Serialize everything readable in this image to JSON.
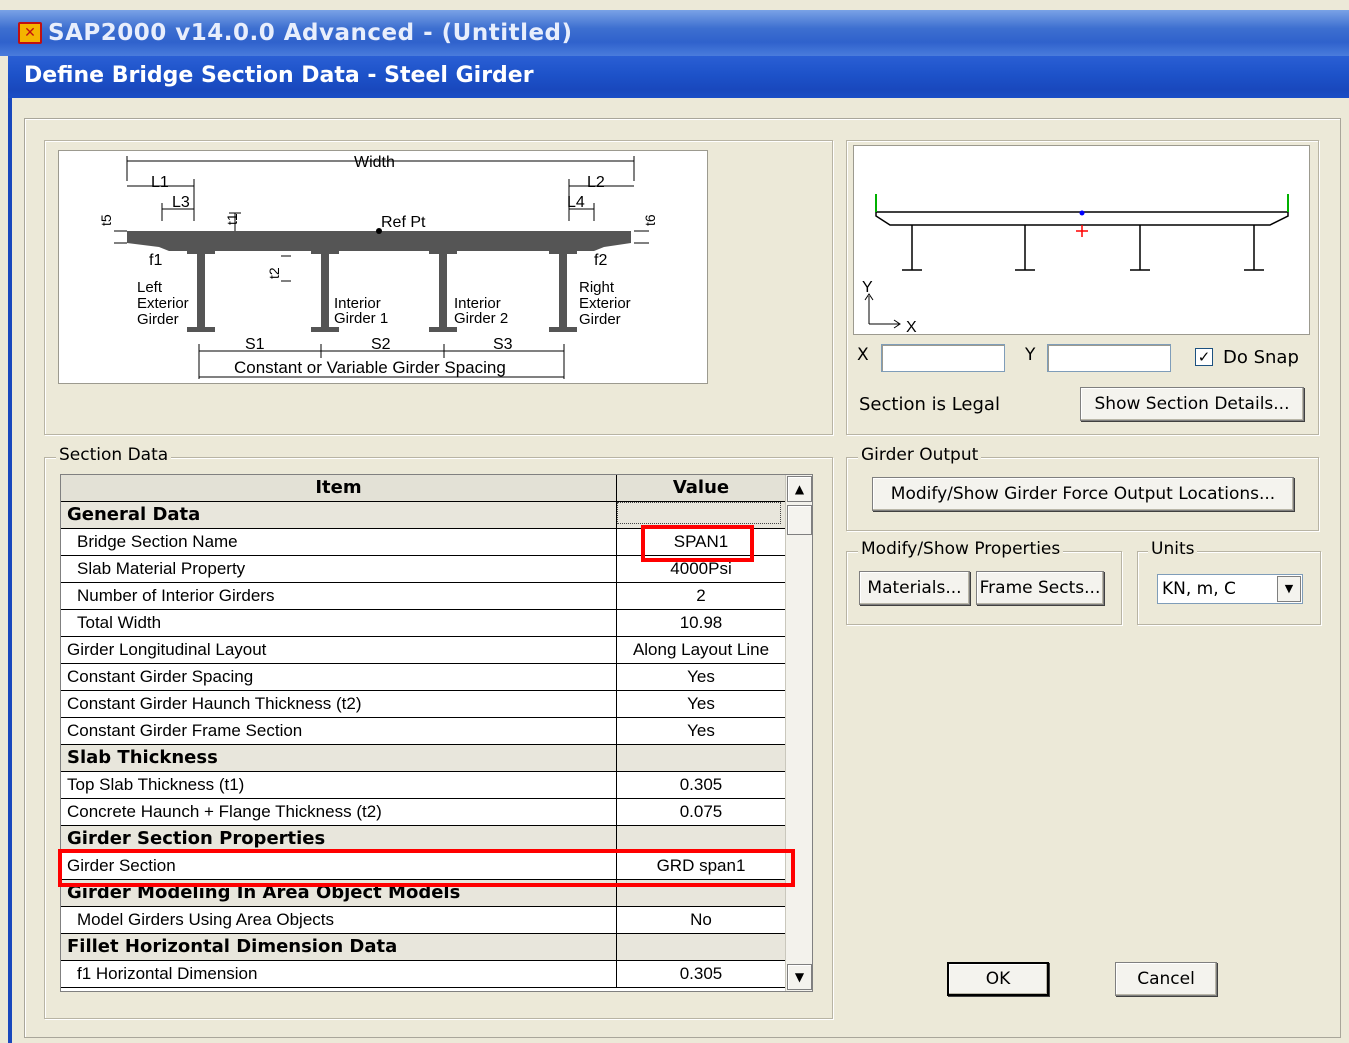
{
  "window": {
    "app_title": "SAP2000 v14.0.0 Advanced  - (Untitled)",
    "dialog_title": "Define Bridge Section Data - Steel Girder"
  },
  "diagram": {
    "width_label": "Width",
    "l1": "L1",
    "l2": "L2",
    "l3": "L3",
    "l4": "L4",
    "t5": "t5",
    "t6": "t6",
    "t1": "t1",
    "t2": "t2",
    "ref_pt": "Ref Pt",
    "f1": "f1",
    "f2": "f2",
    "left_girder": [
      "Left",
      "Exterior",
      "Girder"
    ],
    "interior1": [
      "Interior",
      "Girder 1"
    ],
    "interior2": [
      "Interior",
      "Girder 2"
    ],
    "right_girder": [
      "Right",
      "Exterior",
      "Girder"
    ],
    "s1": "S1",
    "s2": "S2",
    "s3": "S3",
    "spacing_label": "Constant or Variable Girder Spacing"
  },
  "preview": {
    "axis_y": "Y",
    "axis_x": "X",
    "x_label": "X",
    "y_label": "Y",
    "x_value": "",
    "y_value": "",
    "do_snap_label": "Do Snap",
    "do_snap_checked": true,
    "status": "Section is Legal",
    "show_details_button": "Show Section Details..."
  },
  "section_data": {
    "group_label": "Section Data",
    "columns": [
      "Item",
      "Value"
    ],
    "rows": [
      {
        "item": "General Data",
        "value": "",
        "kind": "section"
      },
      {
        "item": "Bridge Section Name",
        "value": "SPAN1",
        "kind": "indent"
      },
      {
        "item": "Slab Material Property",
        "value": "4000Psi",
        "kind": "indent"
      },
      {
        "item": "Number of Interior Girders",
        "value": "2",
        "kind": "indent"
      },
      {
        "item": "Total Width",
        "value": "10.98",
        "kind": "indent"
      },
      {
        "item": "Girder Longitudinal Layout",
        "value": "Along Layout Line",
        "kind": "plain"
      },
      {
        "item": "Constant Girder Spacing",
        "value": "Yes",
        "kind": "plain"
      },
      {
        "item": "Constant Girder Haunch Thickness (t2)",
        "value": "Yes",
        "kind": "plain"
      },
      {
        "item": "Constant Girder Frame Section",
        "value": "Yes",
        "kind": "plain"
      },
      {
        "item": "Slab Thickness",
        "value": "",
        "kind": "section"
      },
      {
        "item": "Top Slab Thickness (t1)",
        "value": "0.305",
        "kind": "plain"
      },
      {
        "item": "Concrete Haunch + Flange Thickness (t2)",
        "value": "0.075",
        "kind": "plain"
      },
      {
        "item": "Girder Section Properties",
        "value": "",
        "kind": "section"
      },
      {
        "item": "Girder Section",
        "value": "GRD span1",
        "kind": "plain"
      },
      {
        "item": "Girder Modeling In Area Object Models",
        "value": "",
        "kind": "section"
      },
      {
        "item": "Model Girders Using Area Objects",
        "value": "No",
        "kind": "indent"
      },
      {
        "item": "Fillet Horizontal Dimension Data",
        "value": "",
        "kind": "section"
      },
      {
        "item": "f1 Horizontal Dimension",
        "value": "0.305",
        "kind": "indent"
      }
    ]
  },
  "girder_output": {
    "group_label": "Girder Output",
    "button": "Modify/Show Girder Force Output Locations..."
  },
  "properties": {
    "group_label": "Modify/Show Properties",
    "materials_button": "Materials...",
    "frame_sects_button": "Frame Sects..."
  },
  "units": {
    "group_label": "Units",
    "selected": "KN, m, C"
  },
  "footer": {
    "ok": "OK",
    "cancel": "Cancel"
  },
  "colors": {
    "title_blue": "#1948bd",
    "highlight_red": "#ff0000",
    "dialog_bg": "#ece9d8"
  }
}
